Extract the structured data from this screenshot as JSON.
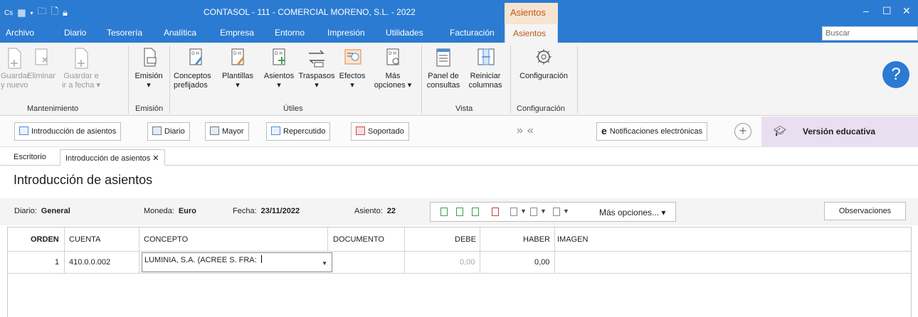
{
  "titlebar": {
    "title": "CONTASOL - 111 - COMERCIAL MORENO, S.L. - 2022",
    "context_tab": "Asientos",
    "minimize": "–",
    "maximize": "☐",
    "close": "✕"
  },
  "menu": {
    "items": [
      "Archivo",
      "Diario",
      "Tesorería",
      "Analítica",
      "Empresa",
      "Entorno",
      "Impresión",
      "Utilidades",
      "Facturación"
    ],
    "active": "Asientos",
    "search_placeholder": "Buscar"
  },
  "ribbon": {
    "mantenimiento": {
      "label": "Mantenimiento",
      "buttons": [
        "Guardar\ny nuevo",
        "Eliminar",
        "Guardar e\nir a fecha ▾"
      ]
    },
    "emision": {
      "label": "Emisión",
      "buttons": [
        "Emisión\n▾"
      ]
    },
    "utiles": {
      "label": "Útiles",
      "buttons": [
        "Conceptos\nprefijados",
        "Plantillas\n▾",
        "Asientos\n▾",
        "Traspasos\n▾",
        "Efectos\n▾",
        "Más\nopciones ▾"
      ]
    },
    "vista": {
      "label": "Vista",
      "buttons": [
        "Panel de\nconsultas",
        "Reiniciar\ncolumnas"
      ]
    },
    "configuracion": {
      "label": "Configuración",
      "buttons": [
        "Configuración"
      ]
    },
    "help": "?"
  },
  "shortcuts": {
    "buttons": [
      "Introducción de asientos",
      "Diario",
      "Mayor",
      "Repercutido",
      "Soportado"
    ],
    "chevrons": "»«",
    "notifications": "Notificaciones electrónicas",
    "plus": "+",
    "edu_label": "Versión educativa"
  },
  "tabs": {
    "escritorio": "Escritorio",
    "active": "Introducción de asientos ✕"
  },
  "page_title": "Introducción de asientos",
  "info": {
    "diario_label": "Diario:",
    "diario_value": "General",
    "moneda_label": "Moneda:",
    "moneda_value": "Euro",
    "fecha_label": "Fecha:",
    "fecha_value": "23/11/2022",
    "asiento_label": "Asiento:",
    "asiento_value": "22",
    "mas_opciones": "Más opciones... ▾",
    "observaciones": "Observaciones"
  },
  "grid": {
    "headers": [
      "ORDEN",
      "CUENTA",
      "CONCEPTO",
      "DOCUMENTO",
      "DEBE",
      "HABER",
      "IMAGEN"
    ],
    "rows": [
      {
        "orden": "1",
        "cuenta": "410.0.0.002",
        "concepto": "LUMINIA, S.A. (ACREE S. FRA:",
        "documento": "",
        "debe": "0,00",
        "haber": "0,00",
        "imagen": ""
      }
    ]
  },
  "colors": {
    "title_blue": "#2b7bd2",
    "context_orange": "#c0561b",
    "edu_purple": "#e9dff0"
  }
}
